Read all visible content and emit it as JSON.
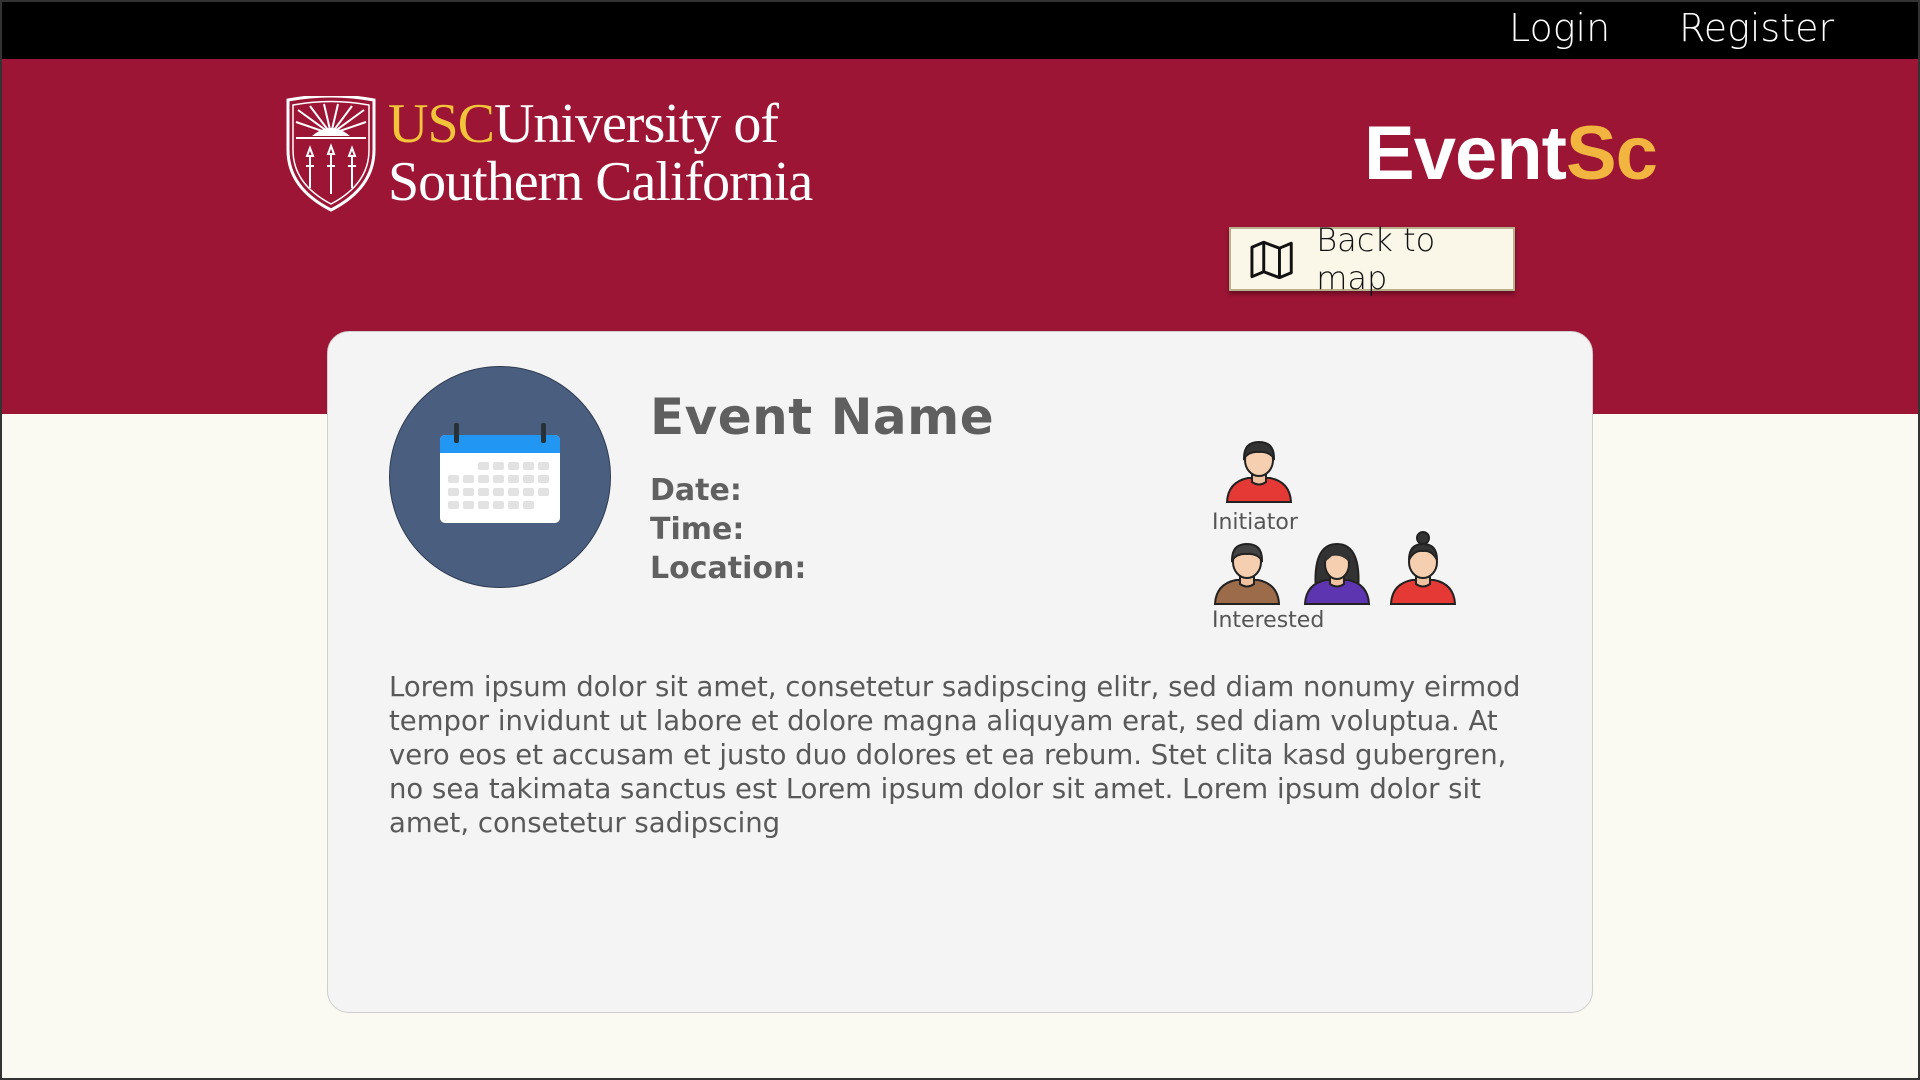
{
  "nav": {
    "login_label": "Login",
    "register_label": "Register"
  },
  "header": {
    "university_abbr": "USC",
    "university_line1": "University of",
    "university_line2": "Southern California",
    "brand_part1": "Event",
    "brand_part2": "Sc",
    "back_to_map_label": "Back to map"
  },
  "event": {
    "name": "Event Name",
    "date_label": "Date:",
    "time_label": "Time:",
    "location_label": "Location:",
    "initiator_label": "Initiator",
    "interested_label": "Interested",
    "description": "Lorem ipsum dolor sit amet, consetetur sadipscing elitr, sed diam nonumy eirmod tempor invidunt ut labore et dolore magna aliquyam erat, sed diam voluptua. At vero eos et accusam et justo duo dolores et ea rebum. Stet clita kasd gubergren, no sea takimata sanctus est Lorem ipsum dolor sit amet. Lorem ipsum dolor sit amet, consetetur sadipscing"
  },
  "icons": {
    "seal": "usc-seal-icon",
    "map": "map-icon",
    "calendar": "calendar-icon",
    "initiator": "person-male-icon",
    "interested": [
      "person-male-icon",
      "person-female-icon",
      "person-female-bun-icon"
    ]
  },
  "colors": {
    "topbar": "#000000",
    "cardinal": "#9c1535",
    "gold": "#f2c43a",
    "brand_accent": "#f2b640",
    "page_bg": "#faf9f2",
    "card_bg": "#f4f4f4",
    "avatar_bg": "#4a5e80"
  }
}
